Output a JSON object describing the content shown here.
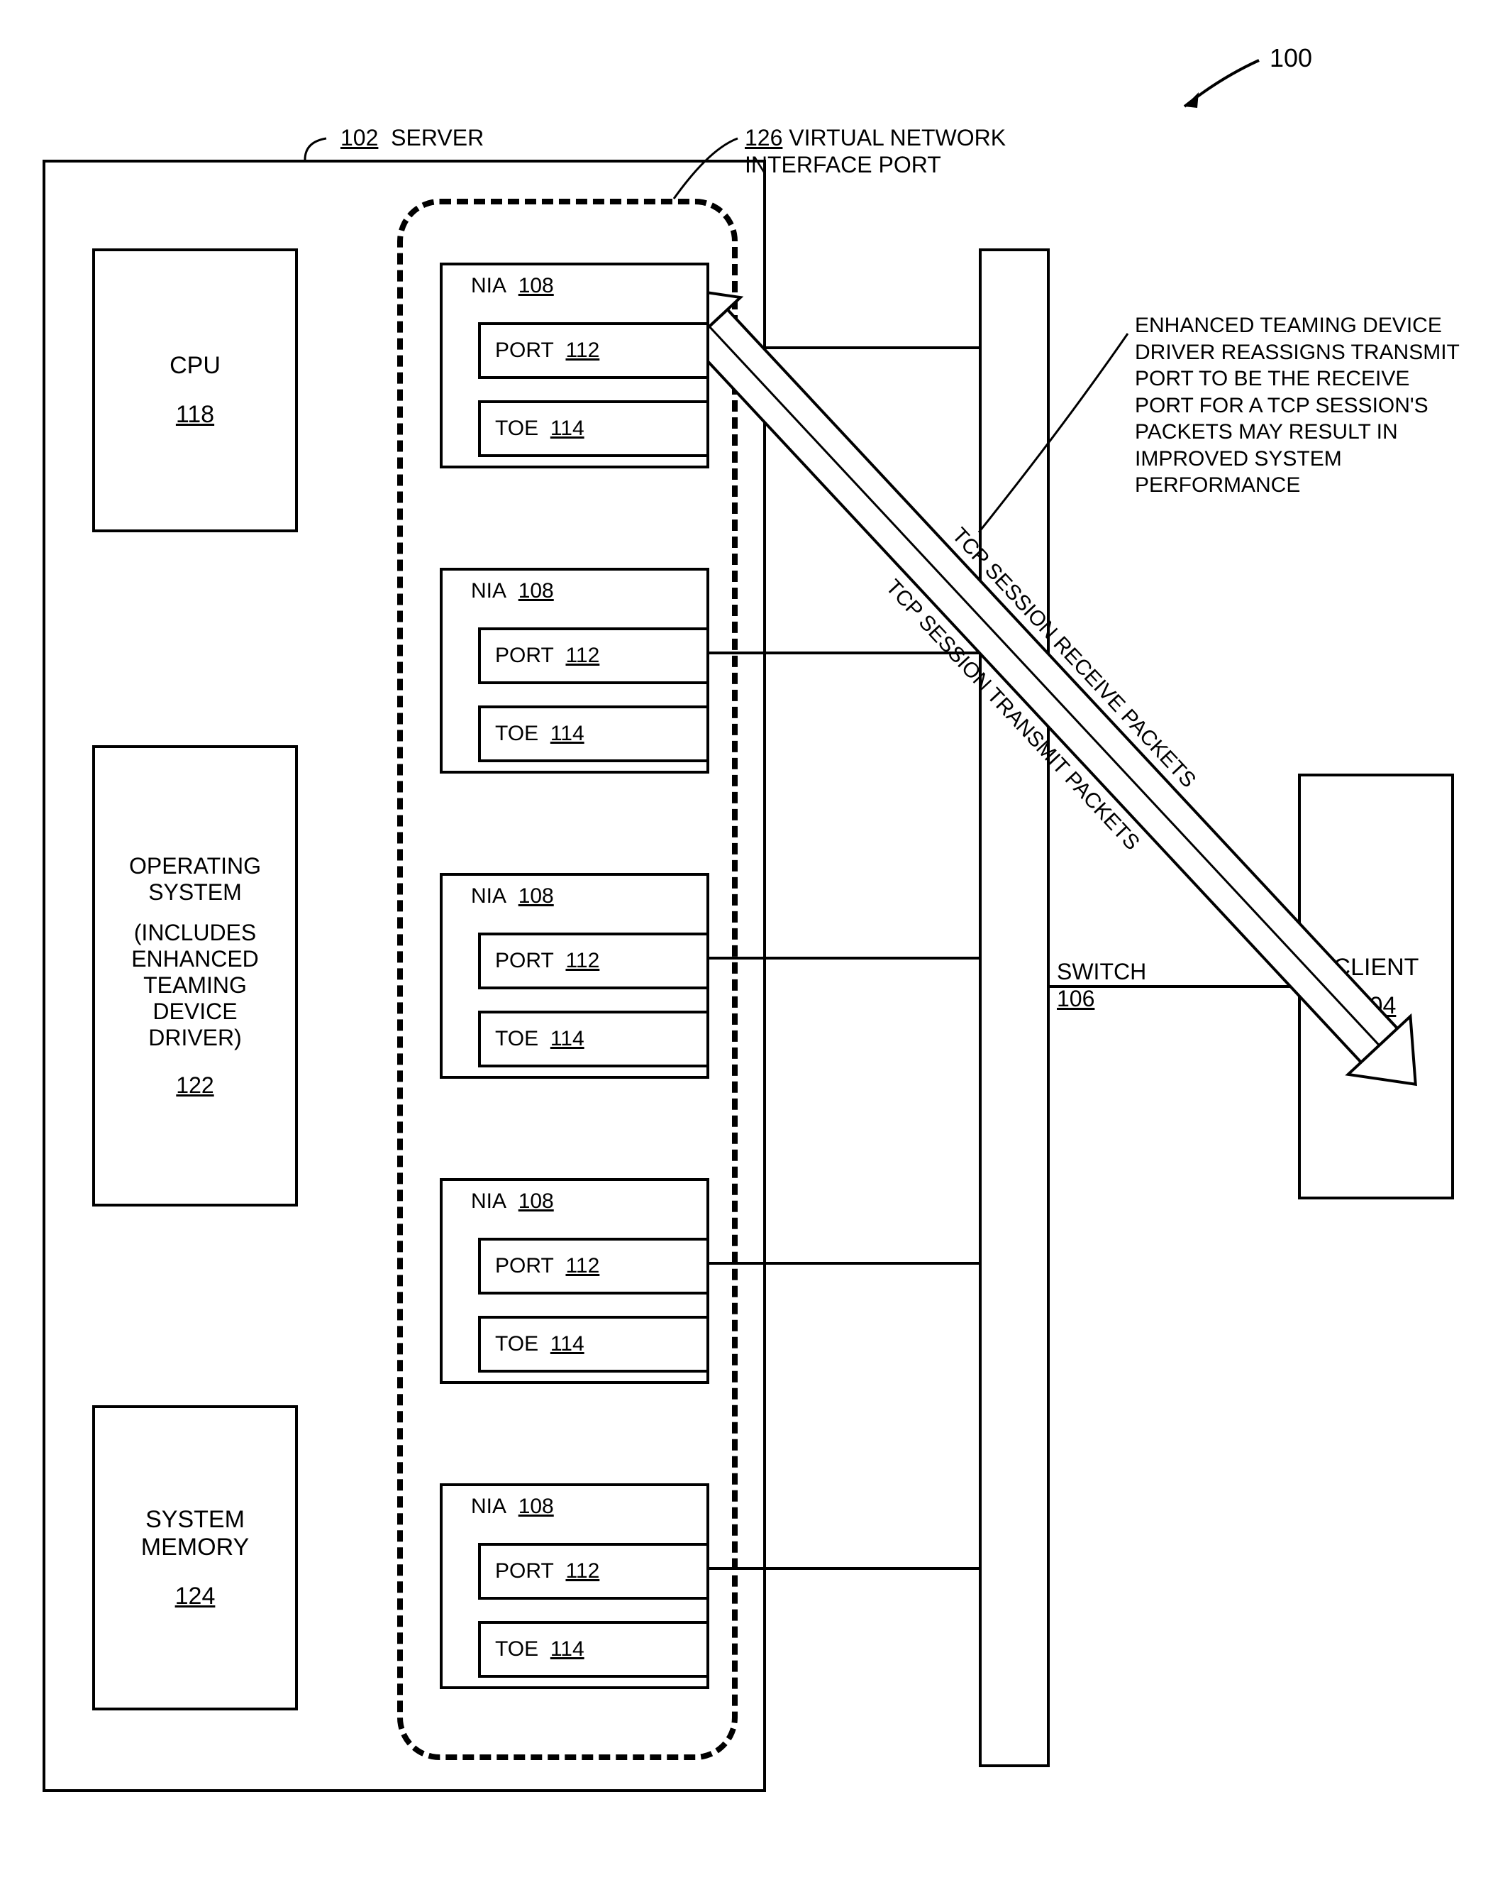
{
  "figure_ref": "100",
  "server": {
    "ref": "102",
    "label": "SERVER"
  },
  "vnip": {
    "ref": "126",
    "label": "VIRTUAL NETWORK INTERFACE PORT"
  },
  "cpu": {
    "label": "CPU",
    "ref": "118"
  },
  "os": {
    "label1": "OPERATING SYSTEM",
    "label2": "(INCLUDES ENHANCED TEAMING DEVICE DRIVER)",
    "ref": "122"
  },
  "mem": {
    "label": "SYSTEM MEMORY",
    "ref": "124"
  },
  "nia": {
    "label": "NIA",
    "ref": "108"
  },
  "port": {
    "label": "PORT",
    "ref": "112"
  },
  "toe": {
    "label": "TOE",
    "ref": "114"
  },
  "switch": {
    "label": "SWITCH",
    "ref": "106"
  },
  "client": {
    "label": "CLIENT",
    "ref": "104"
  },
  "arrow_rx": "TCP SESSION RECEIVE PACKETS",
  "arrow_tx": "TCP SESSION TRANSMIT PACKETS",
  "callout": "ENHANCED TEAMING DEVICE DRIVER REASSIGNS TRANSMIT PORT TO BE THE RECEIVE PORT FOR A TCP SESSION'S PACKETS MAY RESULT IN IMPROVED SYSTEM PERFORMANCE"
}
